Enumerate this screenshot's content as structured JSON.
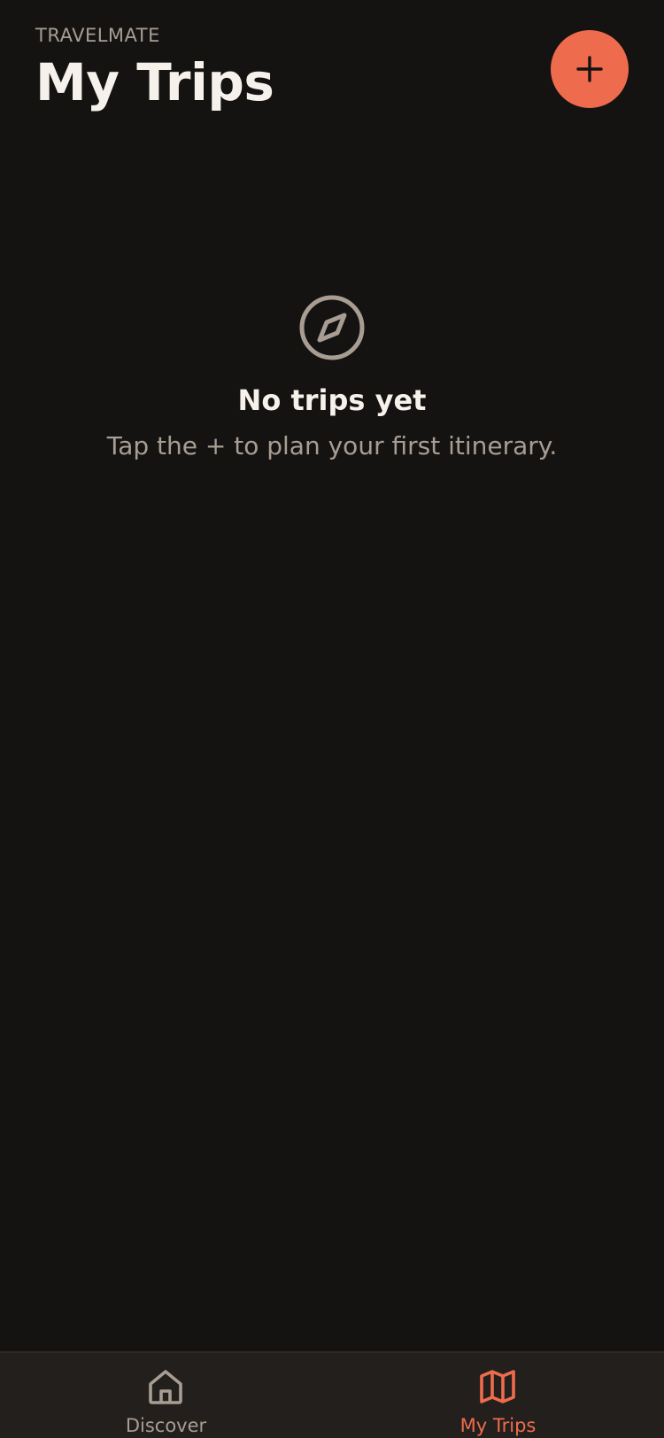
{
  "header": {
    "brand": "TRAVELMATE",
    "title": "My Trips"
  },
  "add_button": {
    "icon": "plus-icon"
  },
  "empty_state": {
    "icon": "compass-icon",
    "title": "No trips yet",
    "subtitle": "Tap the + to plan your first itinerary."
  },
  "tabbar": {
    "tabs": [
      {
        "label": "Discover",
        "icon": "home-icon",
        "active": false
      },
      {
        "label": "My Trips",
        "icon": "map-icon",
        "active": true
      }
    ]
  },
  "colors": {
    "background": "#141312",
    "accent": "#ee6c4d",
    "muted": "#a89d92",
    "text": "#f6f1ea",
    "tabbar": "#221f1c"
  }
}
